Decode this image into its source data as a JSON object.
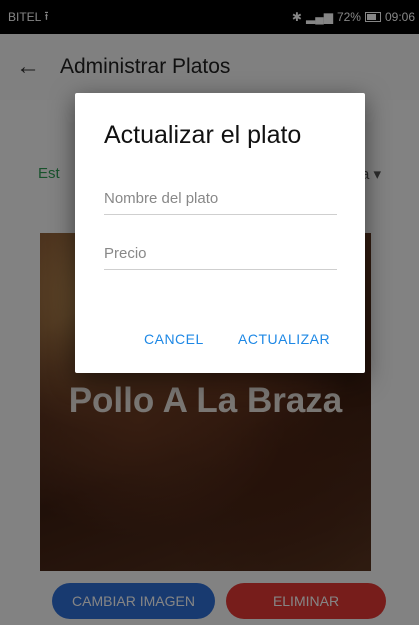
{
  "status": {
    "carrier": "BITEL",
    "battery": "72%",
    "time": "09:06"
  },
  "app_bar": {
    "title": "Administrar Platos"
  },
  "content": {
    "heading": "Actualizar el plato",
    "field_left_label": "Est",
    "field_right_value": "ia",
    "dish_name": "Pollo A La Braza",
    "buttons": {
      "change_image": "CAMBIAR IMAGEN",
      "delete": "ELIMINAR"
    },
    "colors": {
      "change_button": "#2f6fd6",
      "delete_button": "#e53935",
      "field_label": "#2e9e55"
    }
  },
  "dialog": {
    "title": "Actualizar el plato",
    "name_placeholder": "Nombre del plato",
    "price_placeholder": "Precio",
    "cancel_label": "CANCEL",
    "update_label": "ACTUALIZAR",
    "accent_color": "#1e88e5"
  }
}
